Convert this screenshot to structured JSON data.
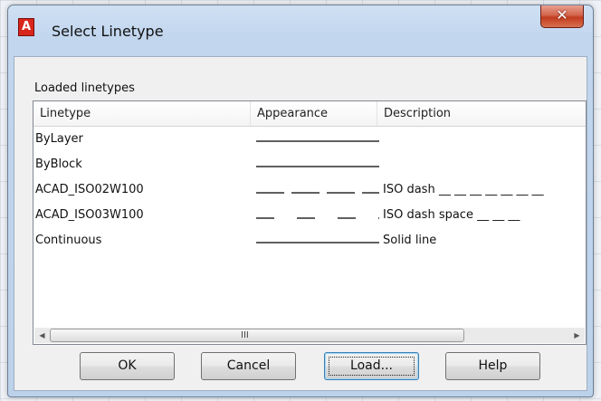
{
  "window": {
    "title": "Select Linetype",
    "app_icon_letter": "A",
    "close_glyph": "✕"
  },
  "section_label": "Loaded linetypes",
  "columns": [
    "Linetype",
    "Appearance",
    "Description"
  ],
  "rows": [
    {
      "name": "ByLayer",
      "pattern": "solid",
      "description": ""
    },
    {
      "name": "ByBlock",
      "pattern": "solid",
      "description": ""
    },
    {
      "name": "ACAD_ISO02W100",
      "pattern": "dash",
      "description": "ISO dash __ __ __ __ __ __ __"
    },
    {
      "name": "ACAD_ISO03W100",
      "pattern": "dash-space",
      "description": "ISO dash space __    __    __"
    },
    {
      "name": "Continuous",
      "pattern": "solid",
      "description": "Solid line"
    }
  ],
  "scrollbar": {
    "grip": "III",
    "left_arrow": "◀",
    "right_arrow": "▶"
  },
  "buttons": {
    "ok": "OK",
    "cancel": "Cancel",
    "load": "Load...",
    "help": "Help"
  }
}
